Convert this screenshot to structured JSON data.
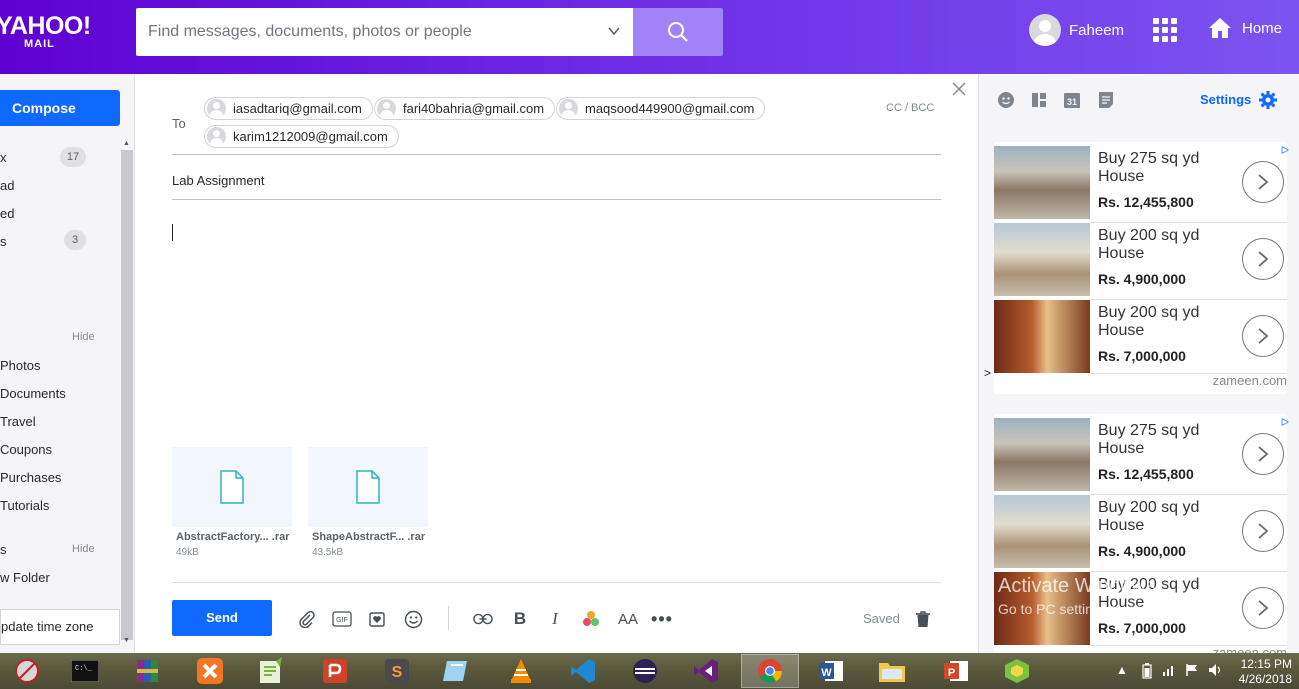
{
  "header": {
    "logo_main": "YAHOO!",
    "logo_sub": "MAIL",
    "search_placeholder": "Find messages, documents, photos or people",
    "user_name": "Faheem",
    "home_label": "Home"
  },
  "sidebar": {
    "compose_label": "Compose",
    "folders": [
      {
        "label": "x",
        "count": "17"
      },
      {
        "label": "ad"
      },
      {
        "label": "ed"
      },
      {
        "label": "s",
        "count": "3"
      }
    ],
    "hide_label_1": "Hide",
    "views": [
      "Photos",
      "Documents",
      "Travel",
      "Coupons",
      "Purchases",
      "Tutorials"
    ],
    "section2_label": "s",
    "hide_label_2": "Hide",
    "new_folder": "w Folder",
    "timezone_popup": "pdate time zone"
  },
  "compose": {
    "to_label": "To",
    "recipients": [
      "iasadtariq@gmail.com",
      "fari40bahria@gmail.com",
      "maqsood449900@gmail.com",
      "karim1212009@gmail.com"
    ],
    "cc_bcc": "CC / BCC",
    "subject": "Lab Assignment",
    "attachments": [
      {
        "name": "AbstractFactory... .rar",
        "size": "49kB"
      },
      {
        "name": "ShapeAbstractF... .rar",
        "size": "43.5kB"
      }
    ],
    "send_label": "Send",
    "status": "Saved"
  },
  "right_panel": {
    "settings_label": "Settings",
    "ads_block_1": [
      {
        "title": "Buy 275 sq yd House",
        "price": "Rs. 12,455,800"
      },
      {
        "title": "Buy 200 sq yd House",
        "price": "Rs. 4,900,000"
      },
      {
        "title": "Buy 200 sq yd House",
        "price": "Rs. 7,000,000"
      }
    ],
    "ad_source_1": "zameen.com",
    "ads_block_2": [
      {
        "title": "Buy 275 sq yd House",
        "price": "Rs. 12,455,800"
      },
      {
        "title": "Buy 200 sq yd House",
        "price": "Rs. 4,900,000"
      },
      {
        "title": "Buy 200 sq yd House",
        "price": "Rs. 7,000,000"
      }
    ],
    "ad_source_2": "zameen.com"
  },
  "watermark": {
    "line1": "Activate Windows",
    "line2": "Go to PC settings to activate Windows."
  },
  "taskbar": {
    "time": "12:15 PM",
    "date": "4/26/2018"
  },
  "colors": {
    "header_gradient_start": "#5f01d1",
    "header_gradient_end": "#7b54f0",
    "accent_blue": "#0f69ff",
    "search_button": "#a183f7"
  }
}
